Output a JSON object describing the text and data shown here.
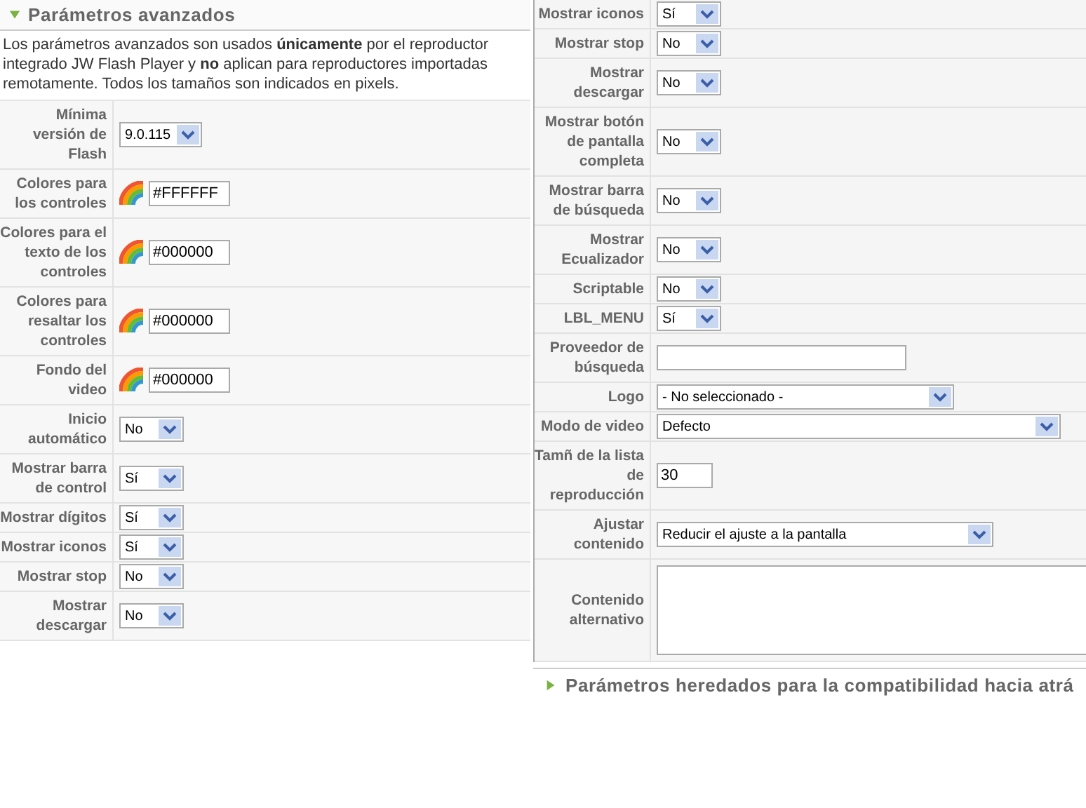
{
  "left_panel": {
    "header": {
      "title": "Parámetros avanzados",
      "expanded": true
    },
    "description": "Los parámetros avanzados son usados **únicamente** por el reproductor integrado JW Flash Player y **no** aplican para reproductores importadas remotamente. Todos los tamaños son indicados en pixels.",
    "rows": [
      {
        "label": "Mínima versión de Flash",
        "kind": "select",
        "value": "9.0.115"
      },
      {
        "label": "Colores para los controles",
        "kind": "color",
        "value": "#FFFFFF"
      },
      {
        "label": "Colores para el texto de los controles",
        "kind": "color",
        "value": "#000000"
      },
      {
        "label": "Colores para resaltar los controles",
        "kind": "color",
        "value": "#000000"
      },
      {
        "label": "Fondo del video",
        "kind": "color",
        "value": "#000000"
      },
      {
        "label": "Inicio automático",
        "kind": "select",
        "value": "No"
      },
      {
        "label": "Mostrar barra de control",
        "kind": "select",
        "value": "Sí"
      },
      {
        "label": "Mostrar dígitos",
        "kind": "select",
        "value": "Sí"
      },
      {
        "label": "Mostrar iconos",
        "kind": "select",
        "value": "Sí"
      },
      {
        "label": "Mostrar stop",
        "kind": "select",
        "value": "No"
      },
      {
        "label": "Mostrar descargar",
        "kind": "select",
        "value": "No"
      }
    ]
  },
  "right_panel": {
    "rows": [
      {
        "label": "Mostrar iconos",
        "kind": "select",
        "value": "Sí"
      },
      {
        "label": "Mostrar stop",
        "kind": "select",
        "value": "No"
      },
      {
        "label": "Mostrar descargar",
        "kind": "select",
        "value": "No"
      },
      {
        "label": "Mostrar botón de pantalla completa",
        "kind": "select",
        "value": "No"
      },
      {
        "label": "Mostrar barra de búsqueda",
        "kind": "select",
        "value": "No"
      },
      {
        "label": "Mostrar Ecualizador",
        "kind": "select",
        "value": "No"
      },
      {
        "label": "Scriptable",
        "kind": "select",
        "value": "No"
      },
      {
        "label": "LBL_MENU",
        "kind": "select",
        "value": "Sí"
      },
      {
        "label": "Proveedor de búsqueda",
        "kind": "text"
      },
      {
        "label": "Logo",
        "kind": "select",
        "value": "- No seleccionado -"
      },
      {
        "label": "Modo de video",
        "kind": "select",
        "value": "Defecto"
      },
      {
        "label": "Tamñ de la lista de reproducción",
        "kind": "text",
        "value": "30"
      },
      {
        "label": "Ajustar contenido",
        "kind": "select",
        "value": "Reducir el ajuste a la pantalla"
      },
      {
        "label": "Contenido alternativo",
        "kind": "textarea"
      }
    ],
    "footer_header": {
      "title": "Parámetros heredados para la compatibilidad hacia atrá",
      "expanded": false
    }
  }
}
